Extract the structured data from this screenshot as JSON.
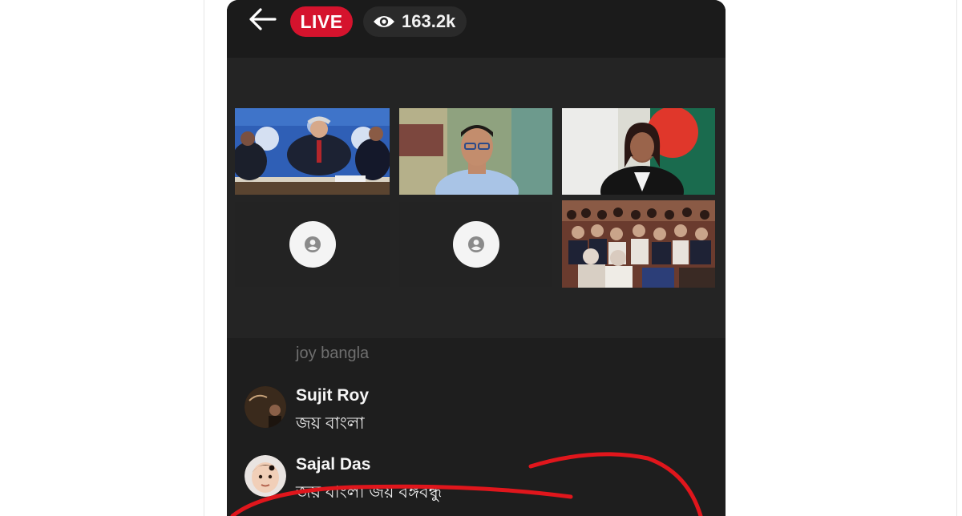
{
  "header": {
    "live_label": "LIVE",
    "viewer_count": "163.2k",
    "icons": {
      "back": "arrow-left-icon",
      "viewers": "eye-icon"
    }
  },
  "participants": [
    {
      "slot": "top-left",
      "type": "video",
      "scene": "press-conference-panel"
    },
    {
      "slot": "top-middle",
      "type": "video",
      "scene": "man-with-glasses"
    },
    {
      "slot": "top-right",
      "type": "video",
      "scene": "woman-speaker-with-flag"
    },
    {
      "slot": "bottom-left",
      "type": "no-video",
      "icon": "user-avatar-icon"
    },
    {
      "slot": "bottom-middle",
      "type": "no-video",
      "icon": "user-avatar-icon"
    },
    {
      "slot": "bottom-right",
      "type": "video",
      "scene": "audience"
    }
  ],
  "chat": {
    "faded_message": "joy bangla",
    "messages": [
      {
        "name": "Sujit Roy",
        "text": "জয় বাংলা"
      },
      {
        "name": "Sajal Das",
        "text": "জয় বাংলা জয় বঙ্গবন্ধু"
      }
    ]
  },
  "colors": {
    "live_red": "#d5132d",
    "background": "#1e1e1e",
    "annotation_red": "#e0161c"
  }
}
